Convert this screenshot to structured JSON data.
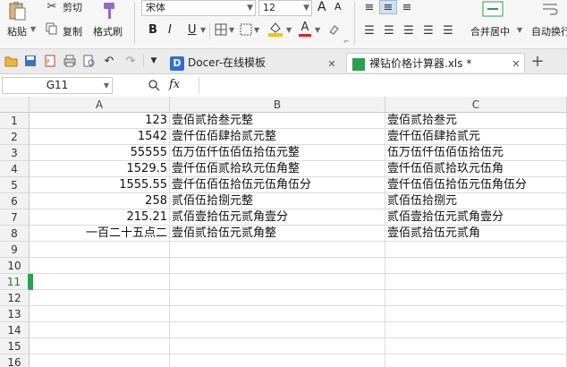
{
  "ribbon": {
    "paste_label": "粘贴",
    "cut_label": "剪切",
    "copy_label": "复制",
    "format_painter_label": "格式刷",
    "font_name": "宋体",
    "font_size": "12",
    "font_grow": "A",
    "font_shrink": "A",
    "bold": "B",
    "italic": "I",
    "underline": "U",
    "font_color_letter": "A",
    "merge_center_label": "合并居中",
    "auto_wrap_label": "自动换行",
    "colors": {
      "fill": "#f5c400",
      "font": "#e02020",
      "accent_green": "#2e9e4f"
    }
  },
  "tabs": [
    {
      "label": "Docer-在线模板",
      "icon": "docer-logo-icon"
    },
    {
      "label": "裸钻价格计算器.xls *",
      "icon": "spreadsheet-icon"
    }
  ],
  "formula_bar": {
    "name_box": "G11",
    "fx_label": "fx",
    "formula": ""
  },
  "sheet": {
    "columns": [
      "A",
      "B",
      "C"
    ],
    "rows": [
      "1",
      "2",
      "3",
      "4",
      "5",
      "6",
      "7",
      "8",
      "9",
      "10",
      "11",
      "12",
      "13",
      "14",
      "15",
      "16"
    ],
    "selected_row": "11",
    "cells": [
      {
        "a": "123",
        "b": "壹佰贰拾叁元整",
        "c": "壹佰贰拾叁元"
      },
      {
        "a": "1542",
        "b": "壹仟伍佰肆拾贰元整",
        "c": "壹仟伍佰肆拾贰元"
      },
      {
        "a": "55555",
        "b": "伍万伍仟伍佰伍拾伍元整",
        "c": "伍万伍仟伍佰伍拾伍元"
      },
      {
        "a": "1529.5",
        "b": "壹仟伍佰贰拾玖元伍角整",
        "c": "壹仟伍佰贰拾玖元伍角"
      },
      {
        "a": "1555.55",
        "b": "壹仟伍佰伍拾伍元伍角伍分",
        "c": "壹仟伍佰伍拾伍元伍角伍分"
      },
      {
        "a": "258",
        "b": "贰佰伍拾捌元整",
        "c": "贰佰伍拾捌元"
      },
      {
        "a": "215.21",
        "b": "贰佰壹拾伍元贰角壹分",
        "c": "贰佰壹拾伍元贰角壹分"
      },
      {
        "a": "一百二十五点二",
        "b": "壹佰贰拾伍元贰角整",
        "c": "壹佰贰拾伍元贰角"
      }
    ]
  }
}
